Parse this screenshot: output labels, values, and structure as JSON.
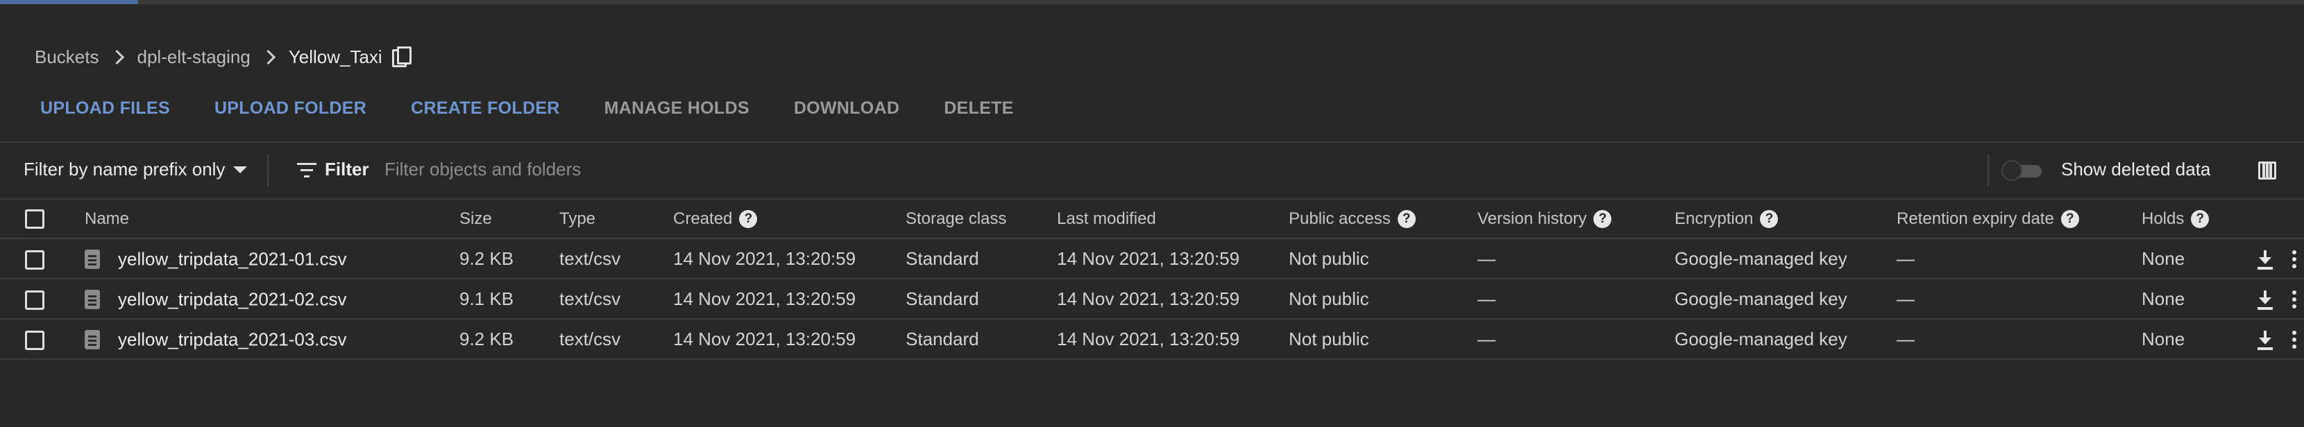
{
  "loading": {
    "progress_percent": 6
  },
  "breadcrumb": {
    "items": [
      {
        "label": "Buckets"
      },
      {
        "label": "dpl-elt-staging"
      }
    ],
    "current": "Yellow_Taxi"
  },
  "toolbar": {
    "actions": [
      {
        "label": "UPLOAD FILES",
        "enabled": true
      },
      {
        "label": "UPLOAD FOLDER",
        "enabled": true
      },
      {
        "label": "CREATE FOLDER",
        "enabled": true
      },
      {
        "label": "MANAGE HOLDS",
        "enabled": false
      },
      {
        "label": "DOWNLOAD",
        "enabled": false
      },
      {
        "label": "DELETE",
        "enabled": false
      }
    ]
  },
  "filter_bar": {
    "prefix_select": "Filter by name prefix only",
    "filter_label": "Filter",
    "filter_placeholder": "Filter objects and folders",
    "toggle_label": "Show deleted data",
    "show_deleted": false
  },
  "table": {
    "columns": [
      {
        "label": "Name",
        "help": false
      },
      {
        "label": "Size",
        "help": false
      },
      {
        "label": "Type",
        "help": false
      },
      {
        "label": "Created",
        "help": true
      },
      {
        "label": "Storage class",
        "help": false
      },
      {
        "label": "Last modified",
        "help": false
      },
      {
        "label": "Public access",
        "help": true
      },
      {
        "label": "Version history",
        "help": true
      },
      {
        "label": "Encryption",
        "help": true
      },
      {
        "label": "Retention expiry date",
        "help": true
      },
      {
        "label": "Holds",
        "help": true
      }
    ],
    "help_glyph": "?",
    "rows": [
      {
        "name": "yellow_tripdata_2021-01.csv",
        "size": "9.2 KB",
        "type": "text/csv",
        "created": "14 Nov 2021, 13:20:59",
        "storage_class": "Standard",
        "last_modified": "14 Nov 2021, 13:20:59",
        "public_access": "Not public",
        "version_history": "—",
        "encryption": "Google-managed key",
        "retention": "—",
        "holds": "None"
      },
      {
        "name": "yellow_tripdata_2021-02.csv",
        "size": "9.1 KB",
        "type": "text/csv",
        "created": "14 Nov 2021, 13:20:59",
        "storage_class": "Standard",
        "last_modified": "14 Nov 2021, 13:20:59",
        "public_access": "Not public",
        "version_history": "—",
        "encryption": "Google-managed key",
        "retention": "—",
        "holds": "None"
      },
      {
        "name": "yellow_tripdata_2021-03.csv",
        "size": "9.2 KB",
        "type": "text/csv",
        "created": "14 Nov 2021, 13:20:59",
        "storage_class": "Standard",
        "last_modified": "14 Nov 2021, 13:20:59",
        "public_access": "Not public",
        "version_history": "—",
        "encryption": "Google-managed key",
        "retention": "—",
        "holds": "None"
      }
    ]
  },
  "colors": {
    "background": "#282826",
    "accent": "#6f96d4",
    "progress": "#4f6fa8",
    "disabled_text": "#9a9a9a"
  }
}
